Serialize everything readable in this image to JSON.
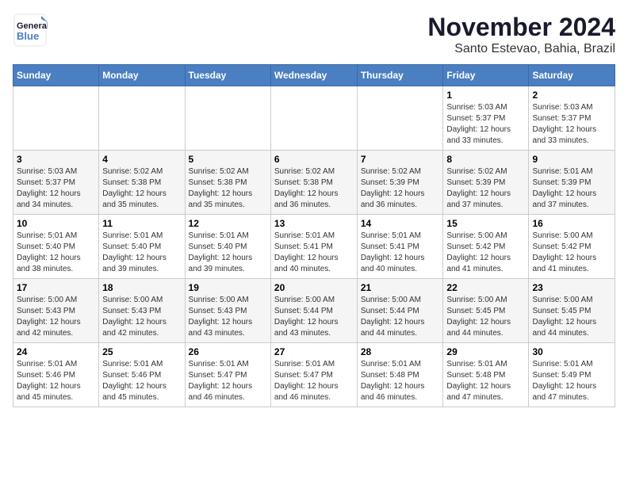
{
  "header": {
    "logo_line1": "General",
    "logo_line2": "Blue",
    "month": "November 2024",
    "location": "Santo Estevao, Bahia, Brazil"
  },
  "weekdays": [
    "Sunday",
    "Monday",
    "Tuesday",
    "Wednesday",
    "Thursday",
    "Friday",
    "Saturday"
  ],
  "weeks": [
    [
      {
        "day": "",
        "info": ""
      },
      {
        "day": "",
        "info": ""
      },
      {
        "day": "",
        "info": ""
      },
      {
        "day": "",
        "info": ""
      },
      {
        "day": "",
        "info": ""
      },
      {
        "day": "1",
        "info": "Sunrise: 5:03 AM\nSunset: 5:37 PM\nDaylight: 12 hours\nand 33 minutes."
      },
      {
        "day": "2",
        "info": "Sunrise: 5:03 AM\nSunset: 5:37 PM\nDaylight: 12 hours\nand 33 minutes."
      }
    ],
    [
      {
        "day": "3",
        "info": "Sunrise: 5:03 AM\nSunset: 5:37 PM\nDaylight: 12 hours\nand 34 minutes."
      },
      {
        "day": "4",
        "info": "Sunrise: 5:02 AM\nSunset: 5:38 PM\nDaylight: 12 hours\nand 35 minutes."
      },
      {
        "day": "5",
        "info": "Sunrise: 5:02 AM\nSunset: 5:38 PM\nDaylight: 12 hours\nand 35 minutes."
      },
      {
        "day": "6",
        "info": "Sunrise: 5:02 AM\nSunset: 5:38 PM\nDaylight: 12 hours\nand 36 minutes."
      },
      {
        "day": "7",
        "info": "Sunrise: 5:02 AM\nSunset: 5:39 PM\nDaylight: 12 hours\nand 36 minutes."
      },
      {
        "day": "8",
        "info": "Sunrise: 5:02 AM\nSunset: 5:39 PM\nDaylight: 12 hours\nand 37 minutes."
      },
      {
        "day": "9",
        "info": "Sunrise: 5:01 AM\nSunset: 5:39 PM\nDaylight: 12 hours\nand 37 minutes."
      }
    ],
    [
      {
        "day": "10",
        "info": "Sunrise: 5:01 AM\nSunset: 5:40 PM\nDaylight: 12 hours\nand 38 minutes."
      },
      {
        "day": "11",
        "info": "Sunrise: 5:01 AM\nSunset: 5:40 PM\nDaylight: 12 hours\nand 39 minutes."
      },
      {
        "day": "12",
        "info": "Sunrise: 5:01 AM\nSunset: 5:40 PM\nDaylight: 12 hours\nand 39 minutes."
      },
      {
        "day": "13",
        "info": "Sunrise: 5:01 AM\nSunset: 5:41 PM\nDaylight: 12 hours\nand 40 minutes."
      },
      {
        "day": "14",
        "info": "Sunrise: 5:01 AM\nSunset: 5:41 PM\nDaylight: 12 hours\nand 40 minutes."
      },
      {
        "day": "15",
        "info": "Sunrise: 5:00 AM\nSunset: 5:42 PM\nDaylight: 12 hours\nand 41 minutes."
      },
      {
        "day": "16",
        "info": "Sunrise: 5:00 AM\nSunset: 5:42 PM\nDaylight: 12 hours\nand 41 minutes."
      }
    ],
    [
      {
        "day": "17",
        "info": "Sunrise: 5:00 AM\nSunset: 5:43 PM\nDaylight: 12 hours\nand 42 minutes."
      },
      {
        "day": "18",
        "info": "Sunrise: 5:00 AM\nSunset: 5:43 PM\nDaylight: 12 hours\nand 42 minutes."
      },
      {
        "day": "19",
        "info": "Sunrise: 5:00 AM\nSunset: 5:43 PM\nDaylight: 12 hours\nand 43 minutes."
      },
      {
        "day": "20",
        "info": "Sunrise: 5:00 AM\nSunset: 5:44 PM\nDaylight: 12 hours\nand 43 minutes."
      },
      {
        "day": "21",
        "info": "Sunrise: 5:00 AM\nSunset: 5:44 PM\nDaylight: 12 hours\nand 44 minutes."
      },
      {
        "day": "22",
        "info": "Sunrise: 5:00 AM\nSunset: 5:45 PM\nDaylight: 12 hours\nand 44 minutes."
      },
      {
        "day": "23",
        "info": "Sunrise: 5:00 AM\nSunset: 5:45 PM\nDaylight: 12 hours\nand 44 minutes."
      }
    ],
    [
      {
        "day": "24",
        "info": "Sunrise: 5:01 AM\nSunset: 5:46 PM\nDaylight: 12 hours\nand 45 minutes."
      },
      {
        "day": "25",
        "info": "Sunrise: 5:01 AM\nSunset: 5:46 PM\nDaylight: 12 hours\nand 45 minutes."
      },
      {
        "day": "26",
        "info": "Sunrise: 5:01 AM\nSunset: 5:47 PM\nDaylight: 12 hours\nand 46 minutes."
      },
      {
        "day": "27",
        "info": "Sunrise: 5:01 AM\nSunset: 5:47 PM\nDaylight: 12 hours\nand 46 minutes."
      },
      {
        "day": "28",
        "info": "Sunrise: 5:01 AM\nSunset: 5:48 PM\nDaylight: 12 hours\nand 46 minutes."
      },
      {
        "day": "29",
        "info": "Sunrise: 5:01 AM\nSunset: 5:48 PM\nDaylight: 12 hours\nand 47 minutes."
      },
      {
        "day": "30",
        "info": "Sunrise: 5:01 AM\nSunset: 5:49 PM\nDaylight: 12 hours\nand 47 minutes."
      }
    ]
  ]
}
